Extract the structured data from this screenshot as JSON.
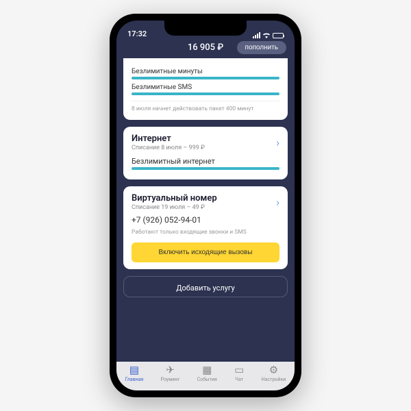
{
  "status": {
    "time": "17:32"
  },
  "header": {
    "balance": "16 905 ₽",
    "topup": "пополнить"
  },
  "card_calls": {
    "line1": "Безлимитные минуты",
    "line2": "Безлимитные SMS",
    "note": "8 июля начнет действовать пакет 400 минут"
  },
  "card_internet": {
    "title": "Интернет",
    "sub": "Списание 8 июля – 999 ₽",
    "line": "Безлимитный интернет"
  },
  "card_virtual": {
    "title": "Виртуальный номер",
    "sub": "Списание 19 июля – 49 ₽",
    "number": "+7 (926) 052-94-01",
    "note": "Работают только входящие звонки и SMS",
    "button": "Включить исходящие вызовы"
  },
  "add_service": "Добавить услугу",
  "tabs": {
    "main": "Главная",
    "roaming": "Роуминг",
    "events": "События",
    "chat": "Чат",
    "settings": "Настройки"
  }
}
